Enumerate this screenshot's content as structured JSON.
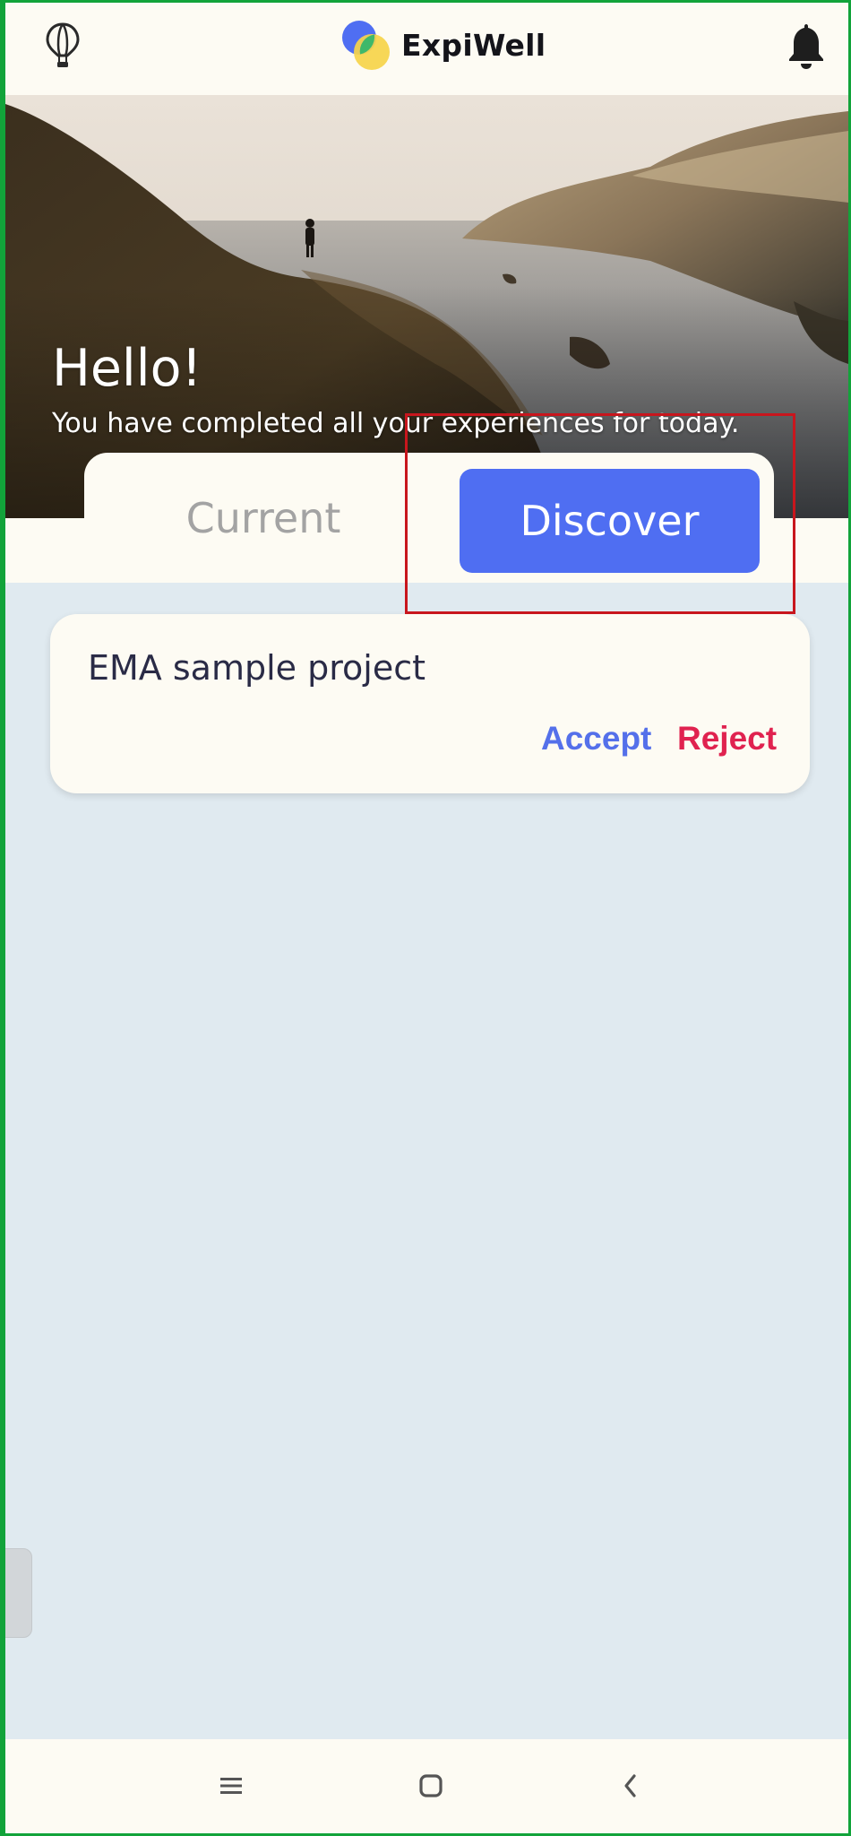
{
  "header": {
    "app_name": "ExpiWell",
    "left_icon": "hot-air-balloon-icon",
    "right_icon": "bell-icon"
  },
  "hero": {
    "greeting": "Hello!",
    "message": "You have completed all your experiences for today."
  },
  "tabs": [
    {
      "label": "Current",
      "active": false
    },
    {
      "label": "Discover",
      "active": true
    }
  ],
  "projects": [
    {
      "title": "EMA sample project",
      "accept_label": "Accept",
      "reject_label": "Reject"
    }
  ],
  "nav": {
    "menu_icon": "recent-apps-icon",
    "home_icon": "home-icon",
    "back_icon": "back-icon"
  },
  "colors": {
    "accent": "#4f6ef2",
    "accept": "#5470ea",
    "reject": "#e0224f",
    "content_bg": "#e0eaf0",
    "surface": "#fdfbf3",
    "highlight": "#c8161d",
    "frame": "#12a33a"
  }
}
